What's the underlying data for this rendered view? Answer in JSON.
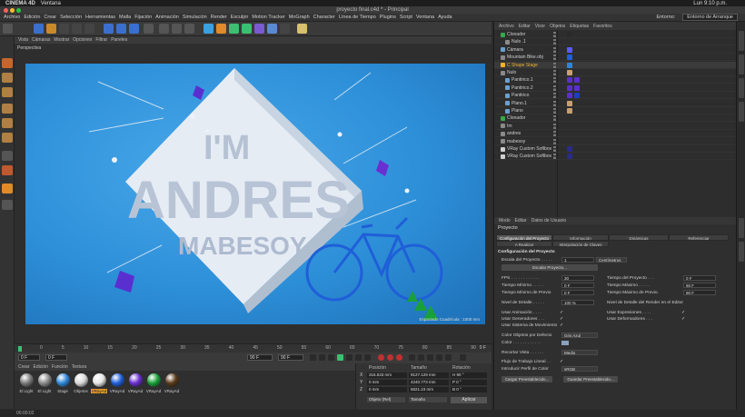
{
  "macbar": {
    "app": "CINEMA 4D",
    "menu1": "Ventana",
    "clock": "Lun 9:10 p.m."
  },
  "window": {
    "title": "proyecto final.c4d * - Principal"
  },
  "menubar": {
    "items": [
      "Archivo",
      "Edición",
      "Crear",
      "Selección",
      "Herramientas",
      "Malla",
      "Fijación",
      "Animación",
      "Simulación",
      "Render",
      "Esculpir",
      "Motion Tracker",
      "MoGraph",
      "Character",
      "Línea de Tiempo",
      "Plugins",
      "Script",
      "Ventana",
      "Ayuda"
    ],
    "env_label": "Entorno:",
    "env_value": "Entorno de Arranque"
  },
  "viewport": {
    "menu": [
      "Vista",
      "Cámaras",
      "Mostrar",
      "Opciones",
      "Filtrar",
      "Paneles"
    ],
    "camera_label": "Perspectiva",
    "grid_info": "Espaciado Cuadrícula : 1000 mm",
    "render_text": {
      "line1": "I'M",
      "line2": "ANDRES",
      "line3": "MABESOY"
    }
  },
  "timeline": {
    "ticks": [
      "0",
      "5",
      "10",
      "15",
      "20",
      "25",
      "30",
      "35",
      "40",
      "45",
      "50",
      "55",
      "60",
      "65",
      "70",
      "75",
      "80",
      "85",
      "90"
    ],
    "frame_end": "0 F"
  },
  "playbar": {
    "current": "0 F",
    "start": "0 F",
    "end": "90 F",
    "max": "90 F"
  },
  "materials": {
    "menu": [
      "Crear",
      "Edición",
      "Función",
      "Textura"
    ],
    "items": [
      {
        "label": "El Light",
        "color": "#7a7a7a",
        "selected": false
      },
      {
        "label": "El Light",
        "color": "#8a8a8a",
        "selected": false
      },
      {
        "label": "Stage",
        "color": "#2f86d6",
        "selected": false
      },
      {
        "label": "Objetos",
        "color": "#d8d8d8",
        "selected": false
      },
      {
        "label": "VRayAd",
        "color": "#e4e4e4",
        "selected": true
      },
      {
        "label": "VRayAd",
        "color": "#1f5fd8",
        "selected": false
      },
      {
        "label": "VRayAd",
        "color": "#6a2fd0",
        "selected": false
      },
      {
        "label": "VRayAd",
        "color": "#1aa03a",
        "selected": false
      },
      {
        "label": "VRayAd",
        "color": "#5a3a1a",
        "selected": false
      }
    ]
  },
  "coords": {
    "headers": {
      "pos": "Posición",
      "size": "Tamaño",
      "rot": "Rotación"
    },
    "rows": [
      {
        "axis": "X",
        "pos": "316.533 mm",
        "size": "9127.129 mm",
        "rot": "H  90 °"
      },
      {
        "axis": "Y",
        "pos": "0 mm",
        "size": "4240.773 mm",
        "rot": "P  0 °"
      },
      {
        "axis": "Z",
        "pos": "0 mm",
        "size": "6821.23 mm",
        "rot": "B  0 °"
      }
    ],
    "mode": "Objeto (Rel)",
    "size_mode": "Tamaño",
    "apply": "Aplicar"
  },
  "objects": {
    "menu": [
      "Archivo",
      "Editar",
      "Visor",
      "Objetos",
      "Etiquetas",
      "Favoritos"
    ],
    "rows": [
      {
        "name": "Clonador",
        "indent": 0,
        "icon": "#38a848",
        "hl": false,
        "tags": [
          "#2a2a2a"
        ]
      },
      {
        "name": "Nulo .1",
        "indent": 1,
        "icon": "#8a8a8a",
        "hl": false,
        "tags": []
      },
      {
        "name": "Cámara",
        "indent": 0,
        "icon": "#6aa0d0",
        "hl": false,
        "tags": [
          "#5a5aff"
        ]
      },
      {
        "name": "Mountain Bike.obj",
        "indent": 0,
        "icon": "#8a8a8a",
        "hl": false,
        "tags": [
          "#1f5fd8"
        ]
      },
      {
        "name": "C Shape Stage",
        "indent": 0,
        "icon": "#f0b030",
        "hl": true,
        "tags": [
          "#2f86d6"
        ]
      },
      {
        "name": "Nulo",
        "indent": 0,
        "icon": "#8a8a8a",
        "hl": false,
        "tags": [
          "#c8a070"
        ]
      },
      {
        "name": "Pantirico.1",
        "indent": 1,
        "icon": "#6aa0d0",
        "hl": false,
        "tags": [
          "#5a2fd0",
          "#5a2fd0"
        ]
      },
      {
        "name": "Pantirico.2",
        "indent": 1,
        "icon": "#6aa0d0",
        "hl": false,
        "tags": [
          "#5a2fd0",
          "#5a2fd0"
        ]
      },
      {
        "name": "Pantirico",
        "indent": 1,
        "icon": "#6aa0d0",
        "hl": false,
        "tags": [
          "#5a2fd0",
          "#1a40c0"
        ]
      },
      {
        "name": "Plano.1",
        "indent": 1,
        "icon": "#6aa0d0",
        "hl": false,
        "tags": [
          "#c8a070"
        ]
      },
      {
        "name": "Plano",
        "indent": 1,
        "icon": "#6aa0d0",
        "hl": false,
        "tags": [
          "#c8a070"
        ]
      },
      {
        "name": "Clonador",
        "indent": 0,
        "icon": "#38a848",
        "hl": false,
        "tags": []
      },
      {
        "name": "Im",
        "indent": 0,
        "icon": "#8a8a8a",
        "hl": false,
        "tags": []
      },
      {
        "name": "andres",
        "indent": 0,
        "icon": "#8a8a8a",
        "hl": false,
        "tags": []
      },
      {
        "name": "mabesoy",
        "indent": 0,
        "icon": "#8a8a8a",
        "hl": false,
        "tags": []
      },
      {
        "name": "VRay Custom Softbox",
        "indent": 0,
        "icon": "#d0d0d0",
        "hl": false,
        "tags": [
          "#2a2a8a"
        ]
      },
      {
        "name": "VRay Custom Softbox",
        "indent": 0,
        "icon": "#d0d0d0",
        "hl": false,
        "tags": [
          "#2a2a8a"
        ]
      }
    ]
  },
  "attributes": {
    "menu": [
      "Modo",
      "Editar",
      "Datos de Usuario"
    ],
    "title": "Proyecto",
    "tabs_row1": [
      "Configuración del Proyecto",
      "Información",
      "Dinámicas",
      "Referenciar"
    ],
    "tabs_row2": [
      "A Realizar",
      "Interpolación de Claves"
    ],
    "section": "Configuración del Proyecto",
    "scale_label": "Escala del Proyecto . . . . .",
    "scale_value": "1",
    "scale_unit": "Centímetros",
    "scale_button": "Escalar Proyecto...",
    "fps_label": "FPS . . . . . . . . . . . .",
    "fps_value": "30",
    "min_time_label": "Tiempo Mínimo . . . . .",
    "min_time_value": "0 F",
    "min_prev_label": "Tiempo Mínimo de Previo",
    "min_prev_value": "0 F",
    "lod_label": "Nivel de Detalle . . . . .",
    "lod_value": "100 %",
    "proj_time_label": "Tiempo del Proyecto . . .",
    "proj_time_value": "0 F",
    "max_time_label": "Tiempo Máximo . . . . .",
    "max_time_value": "90 F",
    "max_prev_label": "Tiempo Máximo de Previo.",
    "max_prev_value": "90 F",
    "render_lod_label": "Nivel de Detalle del Render en el Editor",
    "checks_left": [
      "Usar Animación . . . .",
      "Usar Generadores . . .",
      "Usar Sistema de Movimiento"
    ],
    "checks_right": [
      "Usar Expresiones . . . .",
      "Usar Deformadores . . ."
    ],
    "color_obj_label": "Color Objetos por Defecto",
    "color_obj_value": "Gris Azul",
    "color_label": "Color . . . . . . . . . . . .",
    "clip_label": "Recortar Vista . . . . . .",
    "clip_value": "Medio",
    "linear_label": "Flujo de Trabajo Lineal . .",
    "profile_label": "Introducir Perfil de Color",
    "profile_value": "sRGB",
    "load_preset": "Cargar Preestablecido...",
    "save_preset": "Guardar Preestablecido..."
  },
  "status": {
    "time": "00:00:02"
  }
}
